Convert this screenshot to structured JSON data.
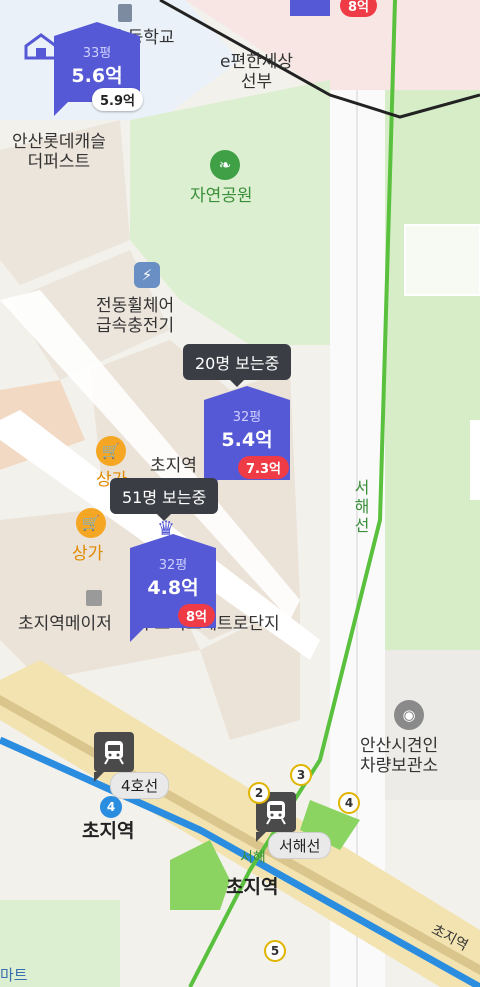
{
  "map": {
    "labels": {
      "school": "초등학교",
      "apt_left": "안산롯데캐슬\n더퍼스트",
      "church": "e편한세상\n선부",
      "park": "자연공원",
      "ev": "전동휠체어\n급속충전기",
      "shop1": "상가",
      "shop2": "상가",
      "apt_mid": "초지역      크단지",
      "apt_bottom": "초지역메이저     푸르지오메트로단지",
      "rail_west": "서해선",
      "vehicle": "안산시견인\n차량보관소",
      "station_left": "초지역",
      "station_right": "초지역",
      "road_label": "초지역",
      "mart": "마트",
      "seohae_small": "서해",
      "road_rt": "초지역"
    },
    "markers": [
      {
        "size": "33평",
        "price": "5.6억",
        "badge": "5.9억",
        "badge_style": "white"
      },
      {
        "size": "32평",
        "price": "5.4억",
        "badge": "7.3억",
        "badge_style": "red"
      },
      {
        "size": "32평",
        "price": "4.8억",
        "badge": "8억",
        "badge_style": "red"
      }
    ],
    "tooltips": {
      "t1": "20명 보는중",
      "t2": "51명 보는중"
    },
    "top_badge": "8억",
    "stations": {
      "line4_chip": "4호선",
      "seohae_chip": "서해선"
    },
    "exits": [
      "3",
      "4",
      "5",
      "2",
      "4"
    ],
    "icons": [
      "park-icon",
      "ev-charger-icon",
      "shopping-cart-icon",
      "subway-icon",
      "crown-icon",
      "apartment-logo-icon",
      "landmark-icon"
    ]
  }
}
